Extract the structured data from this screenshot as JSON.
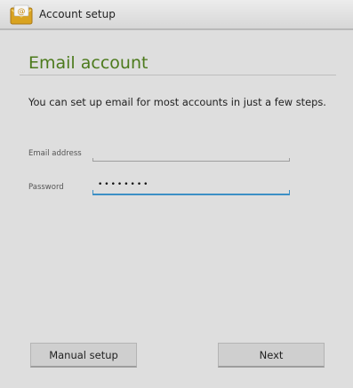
{
  "actionbar": {
    "title": "Account setup",
    "icon": "email-at-icon"
  },
  "main": {
    "heading": "Email account",
    "instructions": "You can set up email for most accounts in just a few steps."
  },
  "form": {
    "email_label": "Email address",
    "email_value": "",
    "password_label": "Password",
    "password_masked": "••••••••"
  },
  "buttons": {
    "manual_setup": "Manual setup",
    "next": "Next"
  },
  "colors": {
    "heading": "#4c7a1c",
    "focus_underline": "#3c8fc5",
    "background": "#dedede"
  }
}
